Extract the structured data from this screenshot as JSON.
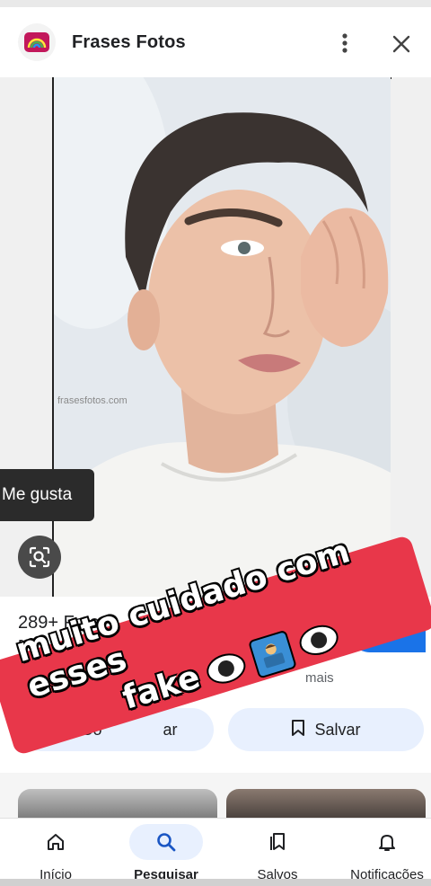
{
  "header": {
    "app_icon": "rainbow-icon",
    "title": "Frases Fotos",
    "more_icon": "more-vert-icon",
    "close_icon": "close-icon"
  },
  "image": {
    "watermark": "frasesfotos.com",
    "caption": "Me gusta",
    "lens_icon": "lens-search-icon"
  },
  "result": {
    "title_line1": "289+ Foto",
    "title_line2": "[N",
    "visit_label": "ar",
    "more_label": "mais",
    "share_label": "Co",
    "share_label_tail": "ar",
    "save_label": "Salvar"
  },
  "overlay": {
    "line1": "muito cuidado com esses",
    "line2": "fake",
    "color": "#e8374a"
  },
  "nav": {
    "items": [
      {
        "label": "Início",
        "icon": "home-icon",
        "active": false
      },
      {
        "label": "Pesquisar",
        "icon": "search-icon",
        "active": true
      },
      {
        "label": "Salvos",
        "icon": "bookmarks-icon",
        "active": false
      },
      {
        "label": "Notificações",
        "icon": "bell-icon",
        "active": false
      }
    ]
  },
  "colors": {
    "accent": "#1a73e8",
    "chip_bg": "#e8f0fe"
  }
}
